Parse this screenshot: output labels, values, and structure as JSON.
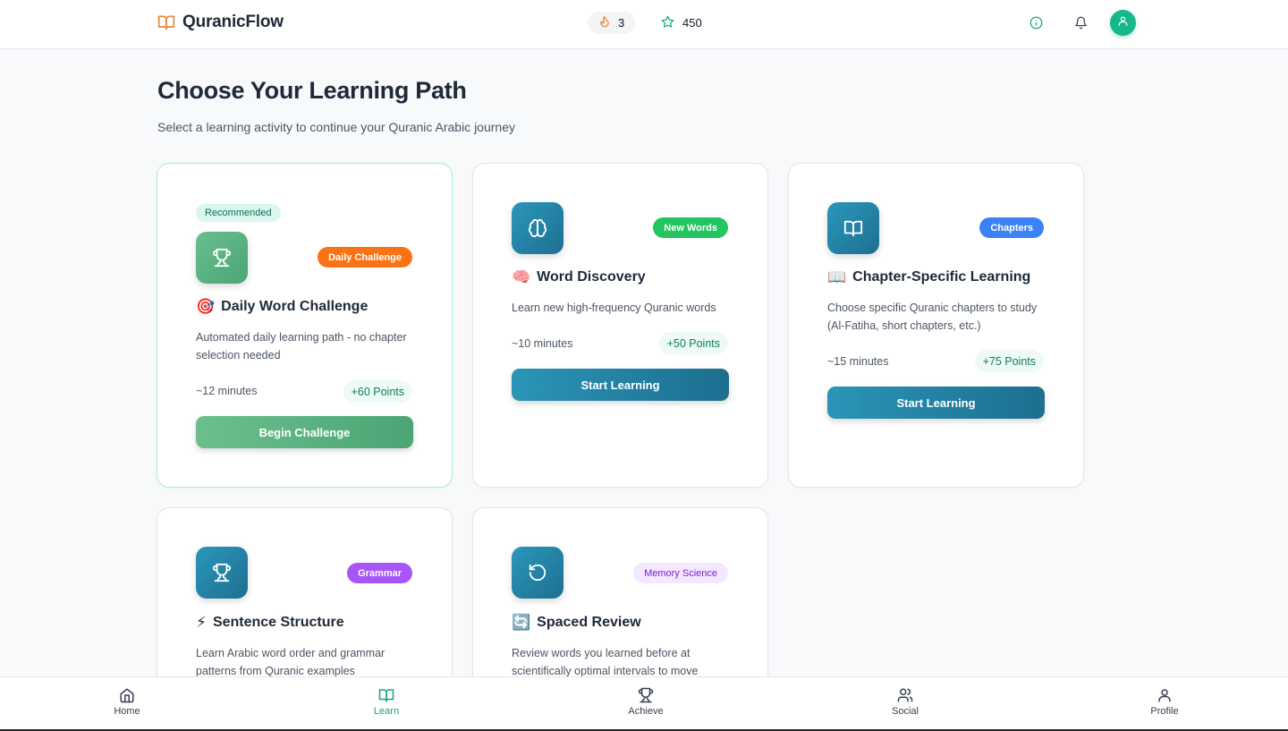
{
  "app": {
    "name": "QuranicFlow"
  },
  "header": {
    "streak_count": "3",
    "stars_count": "450"
  },
  "page": {
    "title": "Choose Your Learning Path",
    "subtitle": "Select a learning activity to continue your Quranic Arabic journey"
  },
  "cards": [
    {
      "chip": "Recommended",
      "tag": "Daily Challenge",
      "emoji": "🎯",
      "title": "Daily Word Challenge",
      "description": "Automated daily learning path - no chapter selection needed",
      "duration": "~12 minutes",
      "points": "+60 Points",
      "button": "Begin Challenge",
      "icon": "trophy-icon"
    },
    {
      "tag": "New Words",
      "emoji": "🧠",
      "title": "Word Discovery",
      "description": "Learn new high-frequency Quranic words",
      "duration": "~10 minutes",
      "points": "+50 Points",
      "button": "Start Learning",
      "icon": "brain-icon"
    },
    {
      "tag": "Chapters",
      "emoji": "📖",
      "title": "Chapter-Specific Learning",
      "description": "Choose specific Quranic chapters to study (Al-Fatiha, short chapters, etc.)",
      "duration": "~15 minutes",
      "points": "+75 Points",
      "button": "Start Learning",
      "icon": "book-icon"
    },
    {
      "tag": "Grammar",
      "emoji": "⚡",
      "title": "Sentence Structure",
      "description": "Learn Arabic word order and grammar patterns from Quranic examples",
      "icon": "trophy-icon"
    },
    {
      "tag": "Memory Science",
      "emoji": "🔄",
      "title": "Spaced Review",
      "description": "Review words you learned before at scientifically optimal intervals to move",
      "icon": "rotate-icon"
    }
  ],
  "nav": [
    {
      "label": "Home",
      "icon": "home-icon"
    },
    {
      "label": "Learn",
      "icon": "book-icon",
      "active": true
    },
    {
      "label": "Achieve",
      "icon": "trophy-icon"
    },
    {
      "label": "Social",
      "icon": "users-icon"
    },
    {
      "label": "Profile",
      "icon": "user-icon"
    }
  ],
  "colors": {
    "primary_green": "#16a37f",
    "accent_teal": "#1e6f91",
    "tag_orange": "#f97316",
    "tag_green": "#22c55e",
    "tag_blue": "#3b82f6",
    "tag_purple": "#a855f7"
  }
}
